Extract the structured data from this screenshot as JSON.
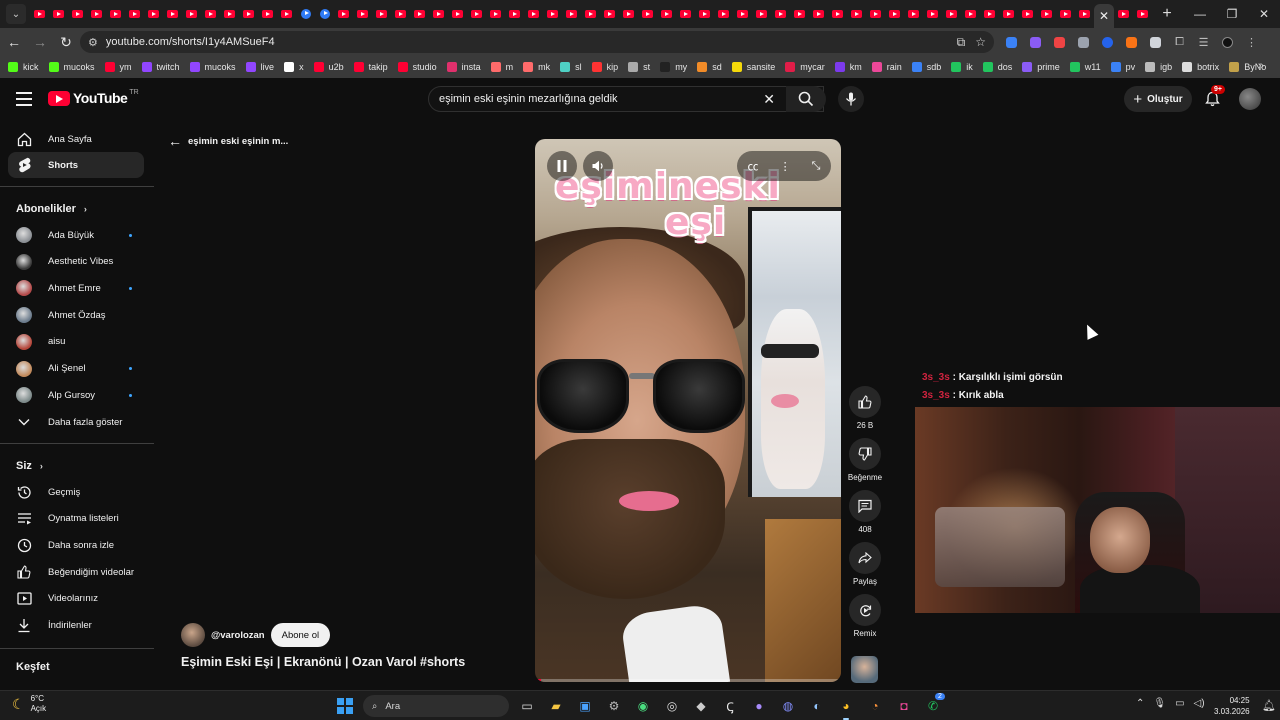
{
  "browser": {
    "url": "youtube.com/shorts/I1y4AMSueF4",
    "bookmarks": [
      {
        "label": "kick",
        "color": "#53fc18"
      },
      {
        "label": "mucoks",
        "color": "#53fc18"
      },
      {
        "label": "ym",
        "color": "#ff0033"
      },
      {
        "label": "twitch",
        "color": "#9146ff"
      },
      {
        "label": "mucoks",
        "color": "#9146ff"
      },
      {
        "label": "live",
        "color": "#9146ff"
      },
      {
        "label": "x",
        "color": "#ffffff"
      },
      {
        "label": "u2b",
        "color": "#ff0033"
      },
      {
        "label": "takip",
        "color": "#ff0033"
      },
      {
        "label": "studio",
        "color": "#ff0033"
      },
      {
        "label": "insta",
        "color": "#e1306c"
      },
      {
        "label": "m",
        "color": "#ff6b6b"
      },
      {
        "label": "mk",
        "color": "#ff6b6b"
      },
      {
        "label": "sl",
        "color": "#4fd1c5"
      },
      {
        "label": "kip",
        "color": "#ff3333"
      },
      {
        "label": "st",
        "color": "#aaaaaa"
      },
      {
        "label": "my",
        "color": "#222222"
      },
      {
        "label": "sd",
        "color": "#f28c28"
      },
      {
        "label": "sansite",
        "color": "#f5d90a"
      },
      {
        "label": "mycar",
        "color": "#e11d48"
      },
      {
        "label": "km",
        "color": "#7c3aed"
      },
      {
        "label": "rain",
        "color": "#ec4899"
      },
      {
        "label": "sdb",
        "color": "#3b82f6"
      },
      {
        "label": "ik",
        "color": "#22c55e"
      },
      {
        "label": "dos",
        "color": "#22c55e"
      },
      {
        "label": "prime",
        "color": "#8b5cf6"
      },
      {
        "label": "w11",
        "color": "#22c55e"
      },
      {
        "label": "pv",
        "color": "#3b82f6"
      },
      {
        "label": "igb",
        "color": "#bbbbbb"
      },
      {
        "label": "botrix",
        "color": "#dddddd"
      },
      {
        "label": "ByNo",
        "color": "#c2a14a"
      }
    ]
  },
  "header": {
    "logo_text": "YouTube",
    "region": "TR",
    "search_query": "eşimin eski eşinin mezarlığına geldik",
    "create_label": "Oluştur",
    "notifications_badge": "9+"
  },
  "sidebar": {
    "main": [
      {
        "label": "Ana Sayfa",
        "icon": "home-icon"
      },
      {
        "label": "Shorts",
        "icon": "shorts-icon"
      }
    ],
    "subscriptions_title": "Abonelikler",
    "subscriptions": [
      {
        "label": "Ada Büyük",
        "dot": true,
        "color": "#8b8f94"
      },
      {
        "label": "Aesthetic Vibes",
        "dot": false,
        "color": "#3a3a3a"
      },
      {
        "label": "Ahmet Emre",
        "dot": true,
        "color": "#b44a4a"
      },
      {
        "label": "Ahmet Özdaş",
        "dot": false,
        "color": "#6b7b8c"
      },
      {
        "label": "aisu",
        "dot": false,
        "color": "#b5463a"
      },
      {
        "label": "Ali Şenel",
        "dot": true,
        "color": "#c28a5c"
      },
      {
        "label": "Alp Gursoy",
        "dot": true,
        "color": "#7d8a8a"
      }
    ],
    "show_more": "Daha fazla göster",
    "you_title": "Siz",
    "you_items": [
      {
        "label": "Geçmiş",
        "icon": "history-icon"
      },
      {
        "label": "Oynatma listeleri",
        "icon": "playlists-icon"
      },
      {
        "label": "Daha sonra izle",
        "icon": "watch-later-icon"
      },
      {
        "label": "Beğendiğim videolar",
        "icon": "liked-videos-icon"
      },
      {
        "label": "Videolarınız",
        "icon": "your-videos-icon"
      },
      {
        "label": "İndirilenler",
        "icon": "downloads-icon"
      }
    ],
    "explore_title": "Keşfet"
  },
  "short": {
    "back_title": "eşimin eski eşinin m...",
    "overlay_text_line1": "eşimineski",
    "overlay_text_line2": "eşi",
    "progress": 0.02,
    "channel": "@varolozan",
    "subscribe_label": "Abone ol",
    "title": "Eşimin Eski Eşi | Ekranönü | Ozan Varol #shorts",
    "likes": "26 B",
    "dislike_label": "Beğenme",
    "comments": "408",
    "share_label": "Paylaş",
    "remix_label": "Remix"
  },
  "stream_chat": [
    {
      "user": "3s_3s",
      "sep": " : ",
      "message": "Karşılıklı işimi görsün"
    },
    {
      "user": "3s_3s",
      "sep": " : ",
      "message": "Kırık abla"
    }
  ],
  "taskbar": {
    "temperature": "6°C",
    "weather_text": "Açık",
    "search_placeholder": "Ara",
    "time": "04:25",
    "date": "3.03.2026",
    "whatsapp_badge": "2"
  }
}
